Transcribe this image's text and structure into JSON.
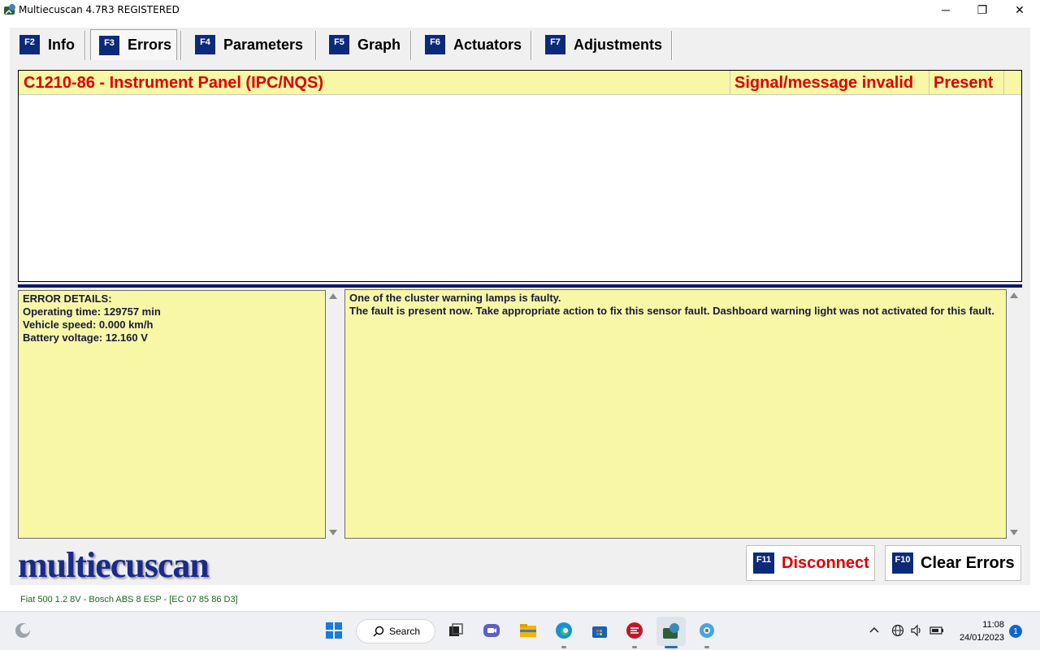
{
  "window": {
    "title": "Multiecuscan 4.7R3 REGISTERED",
    "minimize_glyph": "─",
    "restore_glyph": "❐",
    "close_glyph": "✕"
  },
  "tabs": [
    {
      "key": "F2",
      "label": "Info"
    },
    {
      "key": "F3",
      "label": "Errors"
    },
    {
      "key": "F4",
      "label": "Parameters"
    },
    {
      "key": "F5",
      "label": "Graph"
    },
    {
      "key": "F6",
      "label": "Actuators"
    },
    {
      "key": "F7",
      "label": "Adjustments"
    }
  ],
  "active_tab": "Errors",
  "errors": [
    {
      "code_desc": "C1210-86 - Instrument Panel (IPC/NQS)",
      "type": "Signal/message invalid",
      "status": "Present"
    }
  ],
  "error_details": {
    "heading": "ERROR DETAILS:",
    "lines": [
      "Operating time: 129757 min",
      "Vehicle speed: 0.000 km/h",
      "Battery voltage: 12.160 V"
    ]
  },
  "description": {
    "lines": [
      "One of the cluster warning lamps is faulty.",
      "The fault is present now. Take appropriate action to fix this sensor fault. Dashboard warning light was not activated for this fault."
    ]
  },
  "logo_text": "multiecuscan",
  "buttons": {
    "disconnect": {
      "key": "F11",
      "label": "Disconnect"
    },
    "clear_errors": {
      "key": "F10",
      "label": "Clear Errors"
    }
  },
  "status_line": "Fiat 500 1.2 8V - Bosch ABS 8 ESP - [EC 07 85 86 D3]",
  "taskbar": {
    "search_label": "Search",
    "time": "11:08",
    "date": "24/01/2023",
    "notification_count": "1",
    "icons": [
      "widgets-icon",
      "start-icon",
      "search-icon",
      "task-view-icon",
      "teams-icon",
      "file-explorer-icon",
      "edge-icon",
      "store-icon",
      "bizi-icon",
      "multiecuscan-icon",
      "settings-icon"
    ]
  },
  "colors": {
    "accent_dark_blue": "#0b2a7a",
    "error_red": "#e00000",
    "panel_yellow": "#f7f7a6",
    "status_green": "#1a6a1a"
  }
}
